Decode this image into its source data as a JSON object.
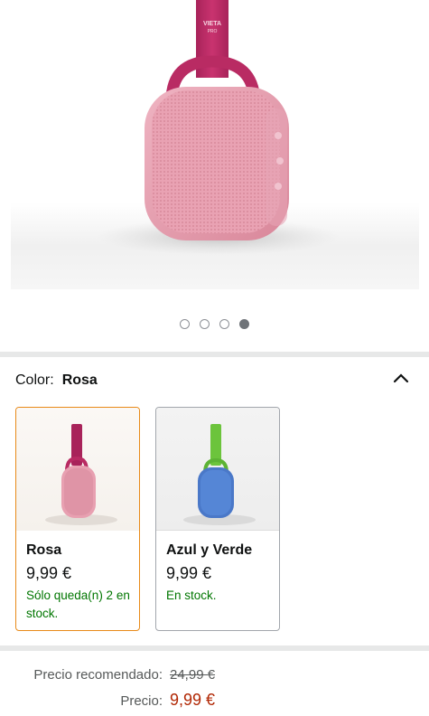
{
  "gallery": {
    "brand_text": "VIETA",
    "brand_sub": "PRO",
    "image_count": 4,
    "active_index": 3
  },
  "color_selector": {
    "label": "Color:",
    "selected": "Rosa",
    "expanded": true
  },
  "variants": [
    {
      "name": "Rosa",
      "price": "9,99 €",
      "stock": "Sólo queda(n) 2 en stock.",
      "selected": true,
      "color": "#e79aab"
    },
    {
      "name": "Azul y Verde",
      "price": "9,99 €",
      "stock": "En stock.",
      "selected": false,
      "color": "#4a78c8"
    }
  ],
  "pricing": {
    "recommended_label": "Precio recomendado:",
    "recommended_value": "24,99 €",
    "price_label": "Precio:",
    "price_value": "9,99 €"
  },
  "colors": {
    "price_red": "#b12704",
    "stock_green": "#007600",
    "selected_border": "#e88a19"
  }
}
